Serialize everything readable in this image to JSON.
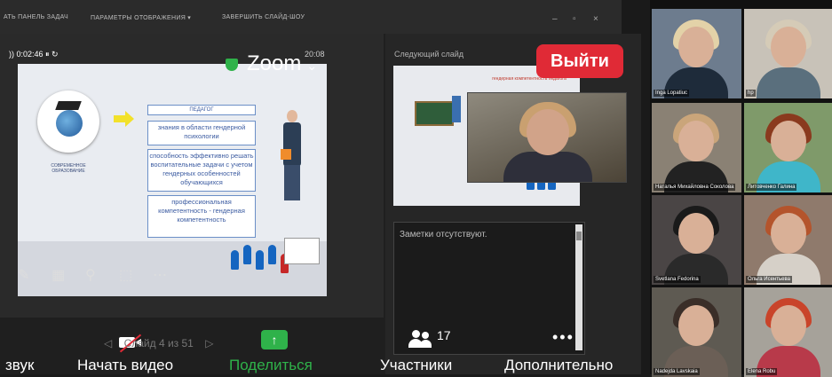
{
  "ribbon": {
    "item1": "АТЬ ПАНЕЛЬ ЗАДАЧ",
    "item2": "ПАРАМЕТРЫ ОТОБРАЖЕНИЯ ▾",
    "item3": "ЗАВЕРШИТЬ СЛАЙД-ШОУ",
    "min": "–",
    "max": "▫",
    "close": "×"
  },
  "presenter": {
    "timer": ")) 0:02:46  ⏸  ↻",
    "clock": "20:08",
    "next_slide_label": "Следующий слайд",
    "notes_text": "Заметки отсутствуют.",
    "slide_nav": "Слайд 4 из 51"
  },
  "slide": {
    "header": "ПЕДАГОГ",
    "box1": "знания в области гендерной психологии",
    "box2": "способность эффективно решать воспитательные задачи с учетом гендерных особенностей обучающихся",
    "box3": "профессиональная компетентность - гендерная компетентность",
    "globe_caption": "СОВРЕМЕННОЕ ОБРАЗОВАНИЕ"
  },
  "next_thumb": {
    "title": "гендерная компетентность педагога"
  },
  "zoom": {
    "label": "Zoom",
    "exit": "Выйти"
  },
  "controls": {
    "audio": "звук",
    "video": "Начать видео",
    "share": "Поделиться",
    "participants": "Участники",
    "participants_count": "17",
    "more": "Дополнительно"
  },
  "gallery": [
    {
      "name": "Inga Lopatiuc",
      "bg": "#6d7c8e",
      "hair": "#e3d2a8",
      "body": "#1e2b3a"
    },
    {
      "name": "hp",
      "bg": "#c8c2b8",
      "hair": "#d5cbb7",
      "body": "#5a6f7d"
    },
    {
      "name": "Наталья Михайловна Соколова",
      "bg": "#8a8174",
      "hair": "#caa57a",
      "body": "#222"
    },
    {
      "name": "Литовченко Галина",
      "bg": "#7f9a6a",
      "hair": "#8a3a1e",
      "body": "#3fb6c9"
    },
    {
      "name": "Svetlana Fedorina",
      "bg": "#4a4545",
      "hair": "#1a1a1a",
      "body": "#2a2a2a"
    },
    {
      "name": "Ольга Исентьева",
      "bg": "#8f7a6c",
      "hair": "#b4542c",
      "body": "#d6d0c8"
    },
    {
      "name": "Nadejda Lavskaia",
      "bg": "#5e5a52",
      "hair": "#3a2e28",
      "body": "#6b5f56"
    },
    {
      "name": "Elena Robu",
      "bg": "#a6a29a",
      "hair": "#c9442a",
      "body": "#b83a4a"
    }
  ]
}
